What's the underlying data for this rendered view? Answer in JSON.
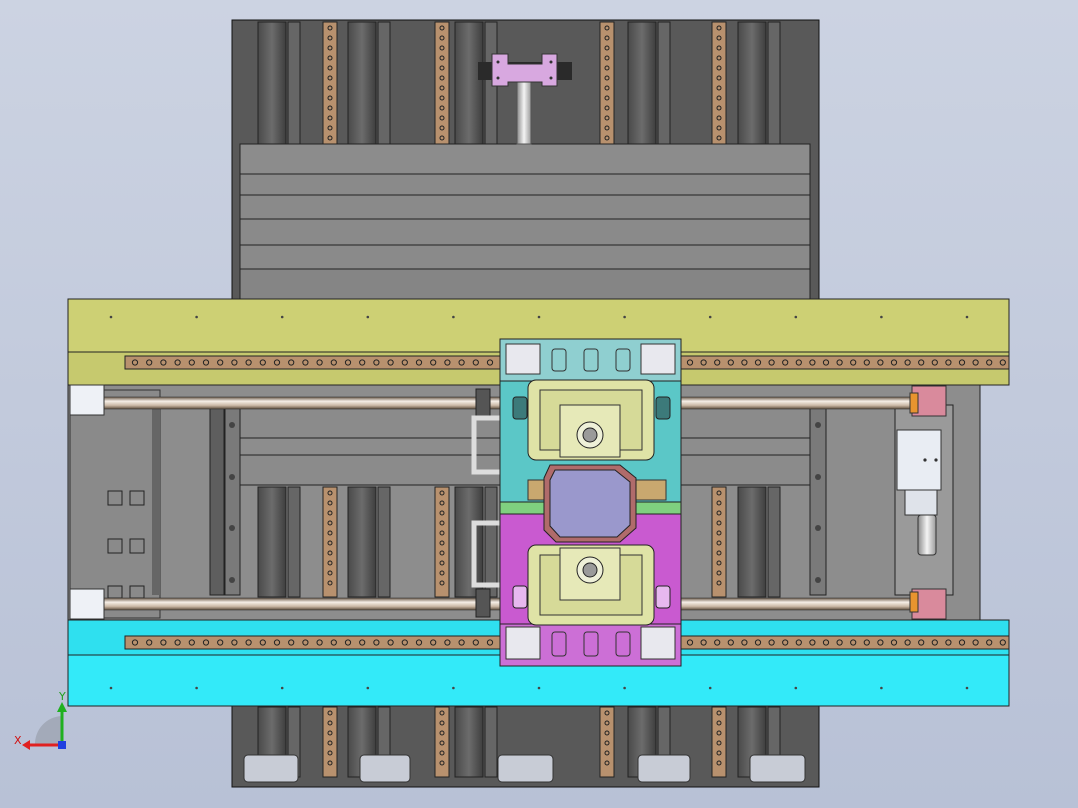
{
  "window": {
    "view": "top",
    "background": "#c4cbdc"
  },
  "axes_triad": {
    "x_label": "X",
    "y_label": "Y",
    "x_color": "#e02020",
    "y_color": "#20b020",
    "z_color": "#2040e0"
  },
  "colors": {
    "frame_dark": "#3f3f3f",
    "frame_gray": "#8a8a8a",
    "rail_yellow": "#cdd074",
    "rail_cyan": "#33eaf9",
    "rail_copper": "#b8916e",
    "carriage_teal": "#5bc7c7",
    "carriage_magenta": "#c95ad0",
    "chuck_cream": "#dfe3a6",
    "part_violet": "#9a98cc",
    "cylinder_pink": "#d98a9c",
    "clamp_pink": "#d8a8e0"
  },
  "model": {
    "guide_rail_holes": 28,
    "rod_count": 2
  }
}
